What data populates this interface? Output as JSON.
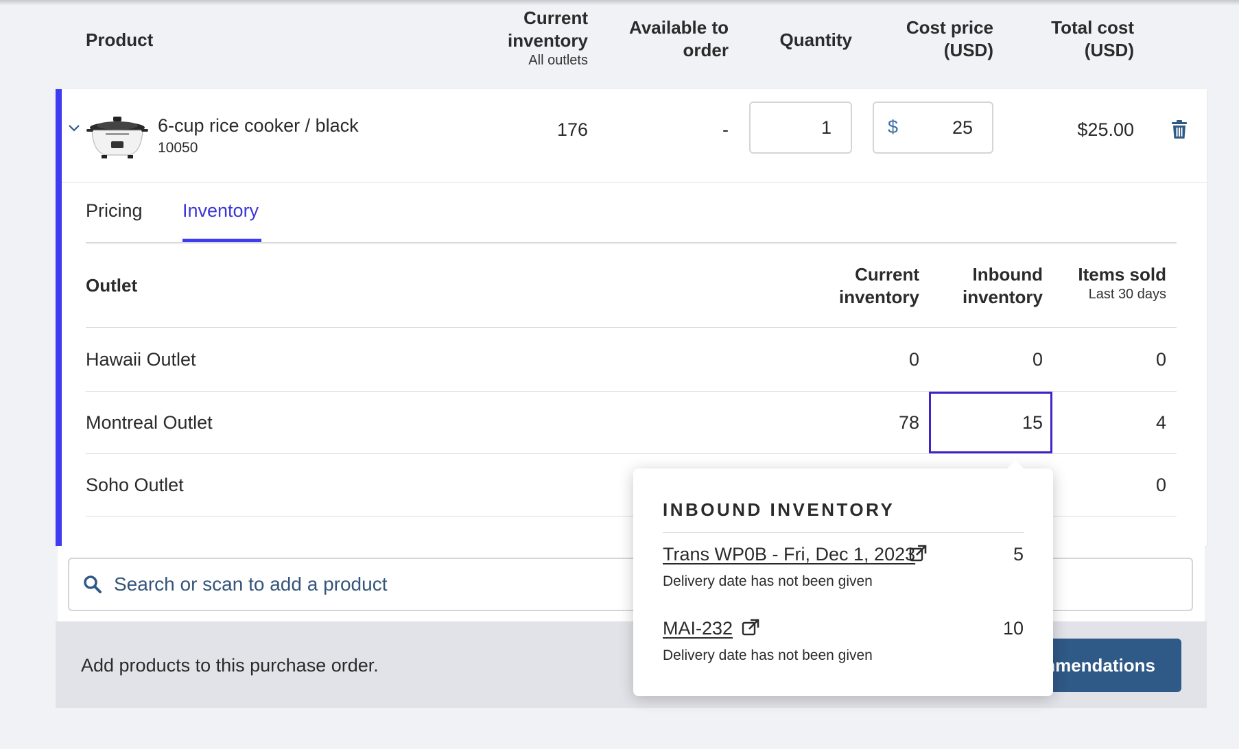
{
  "header": {
    "product": "Product",
    "current_inventory": "Current inventory",
    "current_inventory_sub": "All outlets",
    "available_to_order": "Available to order",
    "quantity": "Quantity",
    "cost_price": "Cost price (USD)",
    "total_cost": "Total cost (USD)"
  },
  "product": {
    "name": "6-cup rice cooker / black",
    "sku": "10050",
    "current_inventory": "176",
    "available_to_order": "-",
    "quantity": "1",
    "cost_currency": "$",
    "cost_price": "25",
    "total_cost": "$25.00"
  },
  "tabs": [
    {
      "label": "Pricing",
      "active": false
    },
    {
      "label": "Inventory",
      "active": true
    }
  ],
  "outlet_table": {
    "headers": {
      "outlet": "Outlet",
      "current_inventory": "Current inventory",
      "inbound_inventory": "Inbound inventory",
      "items_sold": "Items sold",
      "items_sold_sub": "Last 30 days"
    },
    "rows": [
      {
        "outlet": "Hawaii Outlet",
        "current": "0",
        "inbound": "0",
        "sold": "0"
      },
      {
        "outlet": "Montreal Outlet",
        "current": "78",
        "inbound": "15",
        "sold": "4"
      },
      {
        "outlet": "Soho Outlet",
        "current": "",
        "inbound": "",
        "sold": "0"
      }
    ]
  },
  "search": {
    "placeholder": "Search or scan to add a product"
  },
  "footer": {
    "text": "Add products to this purchase order.",
    "button_visible_label": "nmendations"
  },
  "popover": {
    "title": "INBOUND INVENTORY",
    "items": [
      {
        "label": "Trans WP0B - Fri, Dec 1, 2023",
        "quantity": "5",
        "note": "Delivery date has not been given"
      },
      {
        "label": "MAI-232",
        "quantity": "10",
        "note": "Delivery date has not been given"
      }
    ]
  },
  "colors": {
    "accent": "#3f3cf0",
    "link_blue": "#3d35d6",
    "button_blue": "#2f5986",
    "background": "#f1f2f6"
  }
}
